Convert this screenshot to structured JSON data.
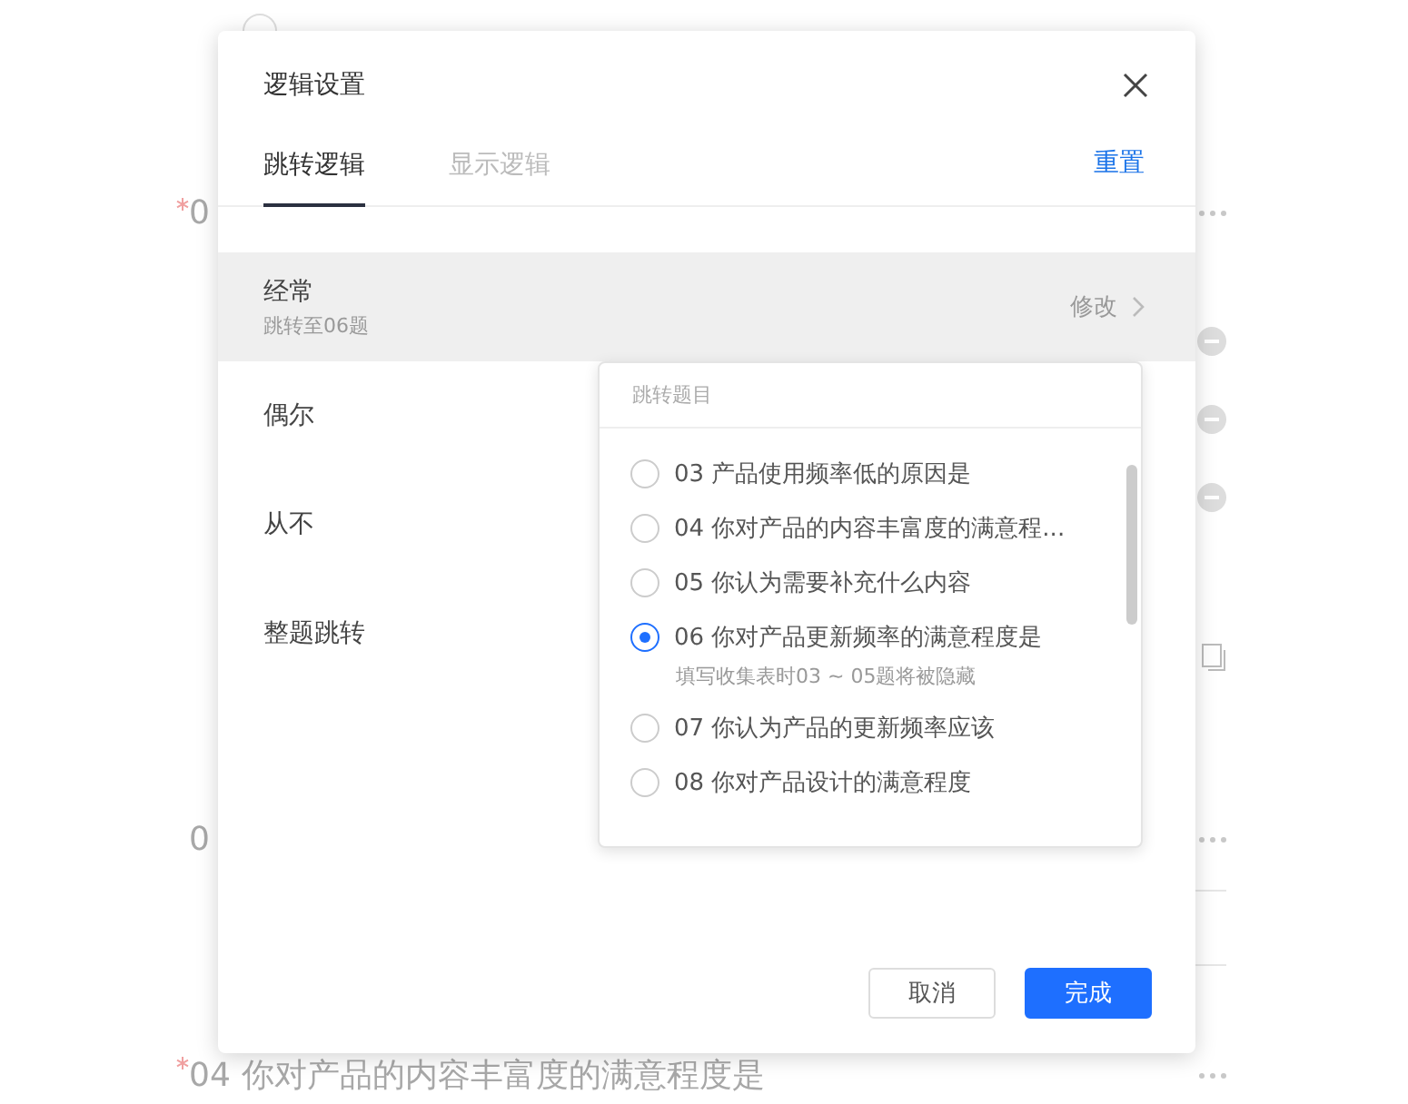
{
  "background": {
    "questions": [
      {
        "number": "0",
        "required": true
      },
      {
        "number": "0",
        "required": false
      },
      {
        "number": "04",
        "required": true,
        "title": "你对产品的内容丰富度的满意程度是"
      }
    ]
  },
  "dialog": {
    "title": "逻辑设置",
    "tabs": [
      {
        "label": "跳转逻辑",
        "selected": true
      },
      {
        "label": "显示逻辑",
        "selected": false
      }
    ],
    "reset": "重置",
    "rules": [
      {
        "label": "经常",
        "detail": "跳转至06题",
        "action": "修改",
        "selected": true
      },
      {
        "label": "偶尔",
        "selected": false
      },
      {
        "label": "从不",
        "selected": false
      },
      {
        "label": "整题跳转",
        "selected": false
      }
    ],
    "dropdown": {
      "header": "跳转题目",
      "options": [
        {
          "label": "03 产品使用频率低的原因是",
          "selected": false
        },
        {
          "label": "04 你对产品的内容丰富度的满意程...",
          "selected": false
        },
        {
          "label": "05 你认为需要补充什么内容",
          "selected": false
        },
        {
          "label": "06 你对产品更新频率的满意程度是",
          "selected": true,
          "hint": "填写收集表时03 ~ 05题将被隐藏"
        },
        {
          "label": "07 你认为产品的更新频率应该",
          "selected": false
        },
        {
          "label": "08 你对产品设计的满意程度",
          "selected": false
        }
      ]
    },
    "buttons": [
      {
        "label": "取消",
        "kind": "secondary"
      },
      {
        "label": "完成",
        "kind": "primary"
      }
    ]
  }
}
